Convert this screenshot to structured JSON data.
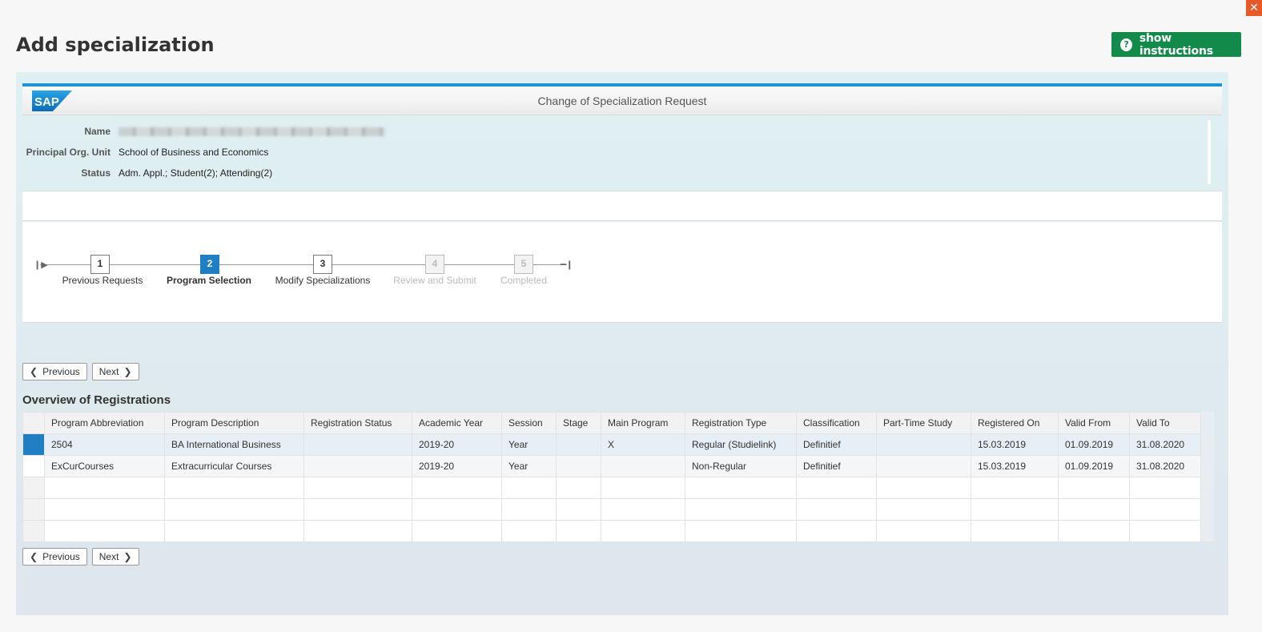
{
  "dialog": {
    "title": "Add specialization",
    "instructions_button": "show instructions",
    "close_symbol": "✕"
  },
  "app": {
    "logo_text": "SAP",
    "title": "Change of Specialization Request"
  },
  "info": {
    "name_label": "Name",
    "org_label": "Principal Org. Unit",
    "org_value": "School of Business and Economics",
    "status_label": "Status",
    "status_value": "Adm. Appl.; Student(2); Attending(2)"
  },
  "roadmap": {
    "steps": [
      {
        "number": "1",
        "label": "Previous Requests",
        "state": "done"
      },
      {
        "number": "2",
        "label": "Program Selection",
        "state": "active"
      },
      {
        "number": "3",
        "label": "Modify Specializations",
        "state": "done"
      },
      {
        "number": "4",
        "label": "Review and Submit",
        "state": "disabled"
      },
      {
        "number": "5",
        "label": "Completed",
        "state": "disabled"
      }
    ]
  },
  "nav": {
    "previous_label": "Previous",
    "next_label": "Next"
  },
  "registrations": {
    "title": "Overview of Registrations",
    "columns": [
      "Program Abbreviation",
      "Program Description",
      "Registration Status",
      "Academic Year",
      "Session",
      "Stage",
      "Main Program",
      "Registration Type",
      "Classification",
      "Part-Time Study",
      "Registered On",
      "Valid From",
      "Valid To"
    ],
    "rows": [
      [
        "2504",
        "BA International Business",
        "",
        "2019-20",
        "Year",
        "",
        "X",
        "Regular (Studielink)",
        "Definitief",
        "",
        "15.03.2019",
        "01.09.2019",
        "31.08.2020"
      ],
      [
        "ExCurCourses",
        "Extracurricular Courses",
        "",
        "2019-20",
        "Year",
        "",
        "",
        "Non-Regular",
        "Definitief",
        "",
        "15.03.2019",
        "01.09.2019",
        "31.08.2020"
      ]
    ]
  },
  "colors": {
    "accent": "#1f7fc2",
    "instructions_green": "#128a4a",
    "close_orange": "#e8592a"
  }
}
